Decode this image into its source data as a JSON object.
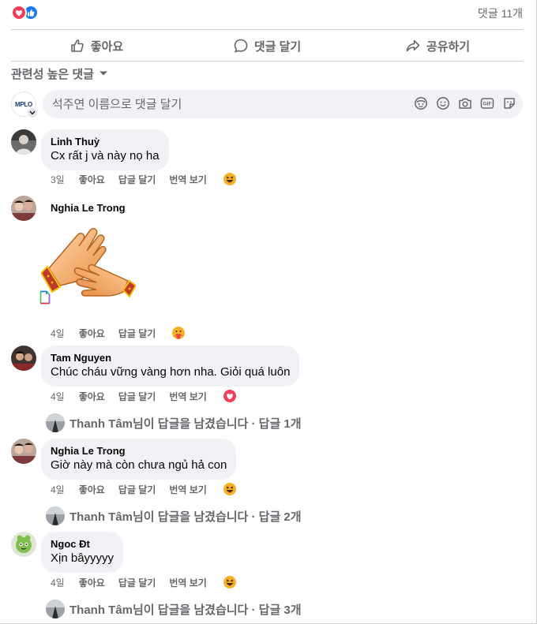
{
  "summary": {
    "comment_count": "댓글 11개",
    "reactions": [
      "love-icon",
      "like-icon"
    ]
  },
  "actions": {
    "like": "좋아요",
    "comment": "댓글 달기",
    "share": "공유하기"
  },
  "filter": {
    "label": "관련성 높은 댓글"
  },
  "composer": {
    "placeholder": "석주연 이름으로 댓글 달기",
    "page_logo": "MPLO",
    "tools": [
      "avatar-sticker-icon",
      "emoji-icon",
      "camera-icon",
      "gif-icon",
      "sticker-icon"
    ]
  },
  "meta_labels": {
    "like": "좋아요",
    "reply": "답글 달기",
    "translate": "번역 보기"
  },
  "comments": [
    {
      "author": "Linh Thuỳ",
      "text": "Cx rất j và này nọ ha",
      "time": "3일",
      "has_translate": true,
      "reaction": "haha-icon"
    },
    {
      "author": "Nghia Le Trong",
      "text": "",
      "sticker": "clapping-hands-sticker",
      "time": "4일",
      "has_translate": false,
      "reaction": "care-icon"
    },
    {
      "author": "Tam Nguyen",
      "text": "Chúc cháu vững vàng hơn nha. Giỏi quá luôn",
      "time": "4일",
      "has_translate": true,
      "reaction": "love-icon",
      "replies": "Thanh Tâm님이 답글을 남겼습니다 · 답글 1개"
    },
    {
      "author": "Nghia Le Trong",
      "text": "Giờ này mà còn chưa ngủ hả con",
      "time": "4일",
      "has_translate": true,
      "reaction": "haha-icon",
      "replies": "Thanh Tâm님이 답글을 남겼습니다 · 답글 2개"
    },
    {
      "author": "Ngoc Đt",
      "text": "Xịn bâyyyyy",
      "time": "4일",
      "has_translate": true,
      "reaction": "haha-icon",
      "replies": "Thanh Tâm님이 답글을 남겼습니다 · 답글 3개"
    }
  ],
  "colors": {
    "like_blue": "#1877f2",
    "love_red": "#f33e58",
    "secondary_text": "#65676b",
    "bubble_bg": "#f0f2f5",
    "haha_yellow": "#f7b125"
  }
}
